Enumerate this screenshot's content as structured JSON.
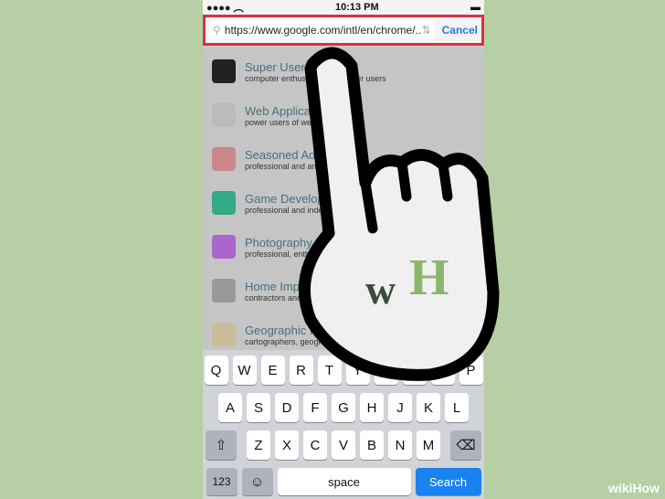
{
  "status": {
    "time": "10:13 PM"
  },
  "urlbar": {
    "url": "https://www.google.com/intl/en/chrome/..",
    "cancel": "Cancel"
  },
  "list": [
    {
      "title": "Super User",
      "subtitle": "computer enthusiasts and power users",
      "color": "#222"
    },
    {
      "title": "Web Applications",
      "subtitle": "power users of web applications",
      "color": "#bbb"
    },
    {
      "title": "Seasoned Advice",
      "subtitle": "professional and amateur chefs",
      "color": "#c88"
    },
    {
      "title": "Game Development",
      "subtitle": "professional and independent game developers",
      "color": "#3a8"
    },
    {
      "title": "Photography",
      "subtitle": "professional, enthusiast and amateur photographers",
      "color": "#a6c"
    },
    {
      "title": "Home Improvement",
      "subtitle": "contractors and serious DIYers",
      "color": "#999"
    },
    {
      "title": "Geographic Information Systems",
      "subtitle": "cartographers, geographers and GIS professionals",
      "color": "#cb9"
    }
  ],
  "keyboard": {
    "row1": [
      "Q",
      "W",
      "E",
      "R",
      "T",
      "Y",
      "U",
      "I",
      "O",
      "P"
    ],
    "row2": [
      "A",
      "S",
      "D",
      "F",
      "G",
      "H",
      "J",
      "K",
      "L"
    ],
    "row3": [
      "Z",
      "X",
      "C",
      "V",
      "B",
      "N",
      "M"
    ],
    "numbers": "123",
    "space": "space",
    "search": "Search"
  },
  "watermark": "wikiHow",
  "logo": "wH"
}
